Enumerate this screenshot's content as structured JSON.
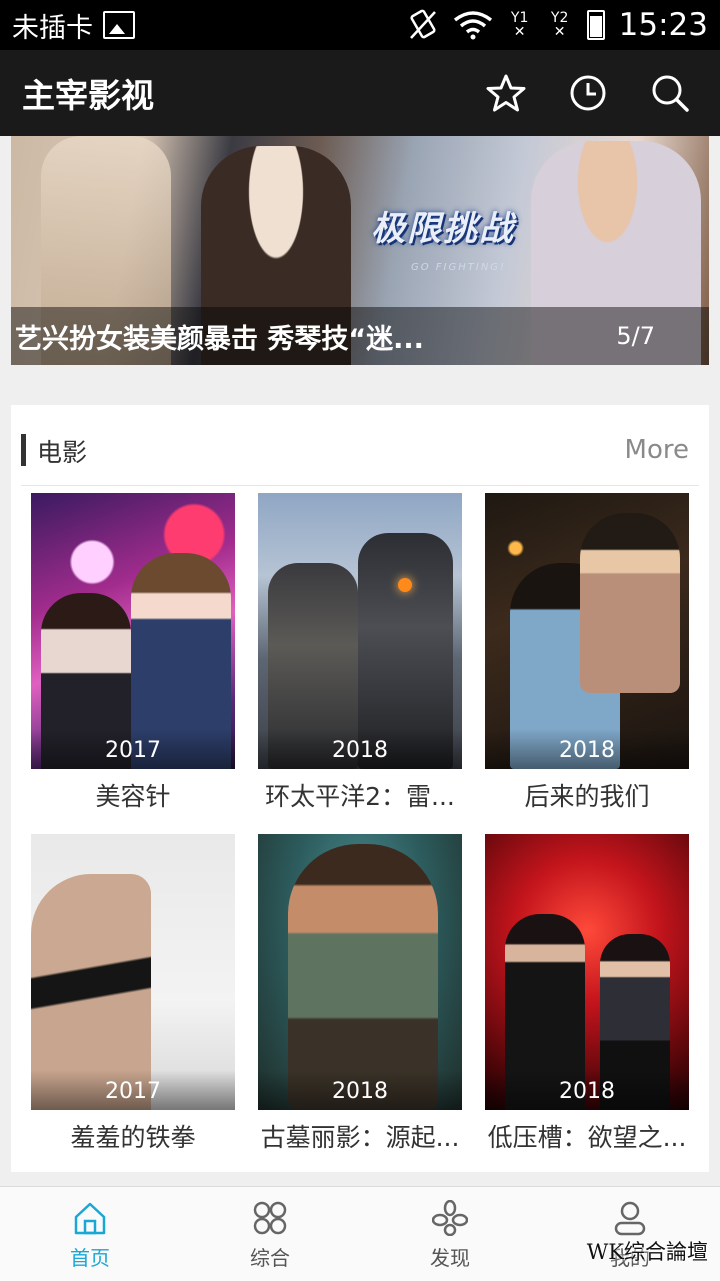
{
  "status_bar": {
    "carrier": "未插卡",
    "sim1": "Y1",
    "sim2": "Y2",
    "time": "15:23"
  },
  "app_bar": {
    "title": "主宰影视",
    "icons": [
      "star-icon",
      "history-clock-icon",
      "search-icon"
    ]
  },
  "banner": {
    "caption": "艺兴扮女装美颜暴击 秀琴技“迷...",
    "page_indicator": "5/7",
    "logo_text": "极限挑战",
    "logo_sub": "GO FIGHTING!"
  },
  "section": {
    "title": "电影",
    "more": "More",
    "movies": [
      {
        "year": "2017",
        "name": "美容针"
      },
      {
        "year": "2018",
        "name": "环太平洋2：雷..."
      },
      {
        "year": "2018",
        "name": "后来的我们"
      },
      {
        "year": "2017",
        "name": "羞羞的铁拳"
      },
      {
        "year": "2018",
        "name": "古墓丽影：源起..."
      },
      {
        "year": "2018",
        "name": "低压槽：欲望之..."
      }
    ]
  },
  "bottom_nav": {
    "tabs": [
      {
        "label": "首页",
        "icon": "home-icon",
        "active": true
      },
      {
        "label": "综合",
        "icon": "grid-icon",
        "active": false
      },
      {
        "label": "发现",
        "icon": "discover-icon",
        "active": false
      },
      {
        "label": "我的",
        "icon": "user-icon",
        "active": false
      }
    ]
  },
  "watermark": "WK综合論壇",
  "colors": {
    "active_tab": "#19a7d6",
    "app_bar_bg": "#1a1a1a"
  }
}
